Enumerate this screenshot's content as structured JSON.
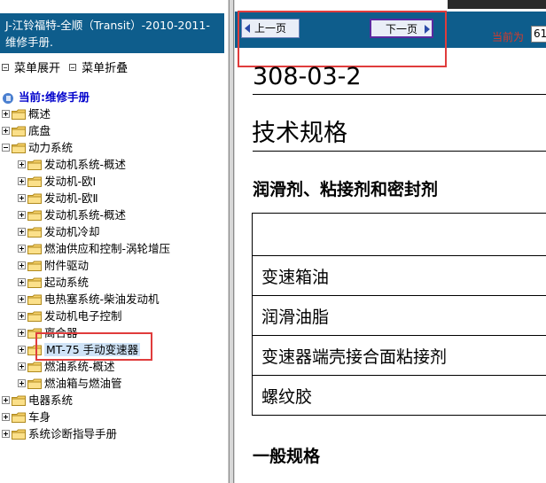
{
  "left_pane": {
    "title": "J-江铃福特-全顺（Transit）-2010-2011-维修手册.",
    "controls": {
      "expand_all": "菜单展开",
      "collapse_all": "菜单折叠"
    },
    "root_label": "当前:维修手册",
    "tree": [
      {
        "label": "概述",
        "level": 0,
        "expanded": false
      },
      {
        "label": "底盘",
        "level": 0,
        "expanded": false
      },
      {
        "label": "动力系统",
        "level": 0,
        "expanded": true
      },
      {
        "label": "发动机系统-概述",
        "level": 1,
        "expanded": false
      },
      {
        "label": "发动机-欧Ⅰ",
        "level": 1,
        "expanded": false
      },
      {
        "label": "发动机-欧Ⅱ",
        "level": 1,
        "expanded": false
      },
      {
        "label": "发动机系统-概述",
        "level": 1,
        "expanded": false
      },
      {
        "label": "发动机冷却",
        "level": 1,
        "expanded": false
      },
      {
        "label": "燃油供应和控制-涡轮增压",
        "level": 1,
        "expanded": false
      },
      {
        "label": "附件驱动",
        "level": 1,
        "expanded": false
      },
      {
        "label": "起动系统",
        "level": 1,
        "expanded": false
      },
      {
        "label": "电热塞系统-柴油发动机",
        "level": 1,
        "expanded": false
      },
      {
        "label": "发动机电子控制",
        "level": 1,
        "expanded": false
      },
      {
        "label": "离合器",
        "level": 1,
        "expanded": false
      },
      {
        "label": "MT-75 手动变速器",
        "level": 1,
        "expanded": false,
        "selected": true
      },
      {
        "label": "燃油系统-概述",
        "level": 1,
        "expanded": false
      },
      {
        "label": "燃油箱与燃油管",
        "level": 1,
        "expanded": false
      },
      {
        "label": "电器系统",
        "level": 0,
        "expanded": false
      },
      {
        "label": "车身",
        "level": 0,
        "expanded": false
      },
      {
        "label": "系统诊断指导手册",
        "level": 0,
        "expanded": false
      }
    ]
  },
  "nav": {
    "prev_label": "上一页",
    "next_label": "下一页",
    "page_label": "当前为",
    "page_value": "61"
  },
  "document": {
    "code": "308-03-2",
    "title": "技术规格",
    "section_heading": "润滑剂、粘接剂和密封剂",
    "table_rows": [
      "",
      "变速箱油",
      "润滑油脂",
      "变速器端壳接合面粘接剂",
      "螺纹胶"
    ],
    "general_heading": "一般规格"
  },
  "colors": {
    "header_blue": "#0e5d8c",
    "highlight_red": "#e03c3c",
    "root_blue": "#0000cc",
    "page_label_red": "#d83a2a"
  }
}
